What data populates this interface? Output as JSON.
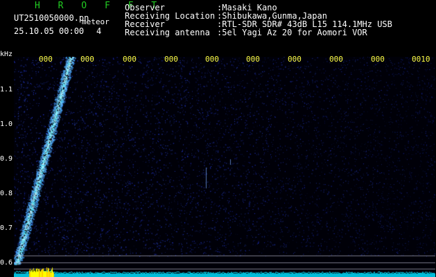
{
  "header": {
    "app_title": "H R O F F T",
    "file_name": "UT2510050000.pn",
    "timestamp": "25.10.05 00:00",
    "mode_label": "meteor",
    "count": "4"
  },
  "station": {
    "labels": [
      "Observer",
      "Receiving Location",
      "Receiver",
      "Receiving antenna"
    ],
    "values": [
      ":Masaki Kano",
      ":Shibukawa,Gunma,Japan",
      ":RTL-SDR SDR# 43dB L15 114.1MHz USB",
      ":5el Yagi Az 20 for Aomori VOR"
    ]
  },
  "axes": {
    "y_unit": "kHz",
    "y_ticks": [
      "1.1",
      "1.0",
      "0.9",
      "0.8",
      "0.7",
      "0.6"
    ],
    "x_ticks": [
      "000",
      "000",
      "000",
      "000",
      "000",
      "000",
      "000",
      "000",
      "000",
      "0010"
    ]
  },
  "colors": {
    "background": "#000000",
    "title": "#22cc22",
    "time_ticks": "#ffff44",
    "spectrum_line": "#00e5ff",
    "meteor_echo": "#33bbff"
  }
}
